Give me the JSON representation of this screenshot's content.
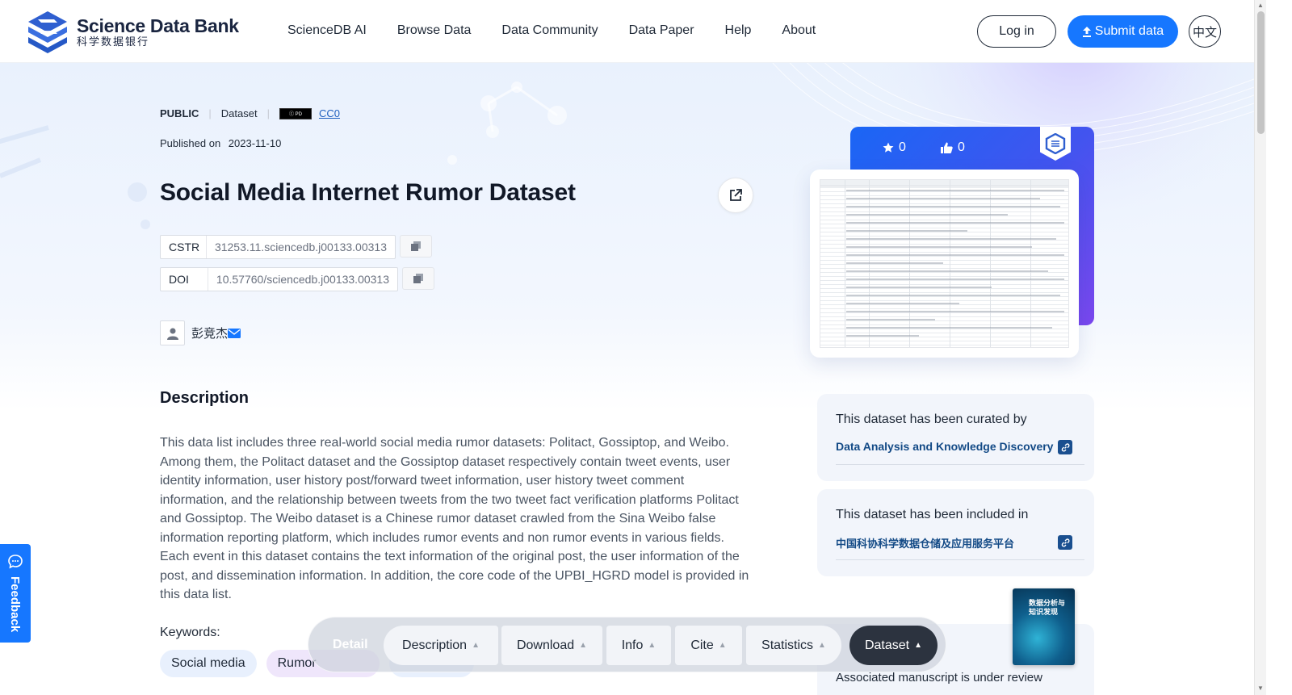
{
  "brand": {
    "name_en": "Science Data Bank",
    "name_cn": "科学数据银行"
  },
  "nav": [
    "ScienceDB AI",
    "Browse Data",
    "Data Community",
    "Data Paper",
    "Help",
    "About"
  ],
  "header_actions": {
    "login": "Log in",
    "submit": "Submit data",
    "lang": "中文"
  },
  "dataset": {
    "visibility": "PUBLIC",
    "type": "Dataset",
    "license": "CC0",
    "published_label": "Published on",
    "published_date": "2023-11-10",
    "title": "Social Media Internet Rumor Dataset",
    "cstr_label": "CSTR",
    "cstr": "31253.11.sciencedb.j00133.00313",
    "doi_label": "DOI",
    "doi": "10.57760/sciencedb.j00133.00313",
    "author": "彭竞杰"
  },
  "description": {
    "heading": "Description",
    "text": "This data list includes three real-world social media rumor datasets: Politact, Gossiptop, and Weibo. Among them, the Politact dataset and the Gossiptop dataset respectively contain tweet events, user identity information, user history post/forward tweet information, user history tweet comment information, and the relationship between tweets from the two tweet fact verification platforms Politact and Gossiptop. The Weibo dataset is a Chinese rumor dataset crawled from the Sina Weibo false information reporting platform, which includes rumor events and non rumor events in various fields. Each event in this dataset contains the text information of the original post, the user information of the post, and dissemination information. In addition, the core code of the UPBI_HGRD model is provided in this data list."
  },
  "keywords": {
    "label": "Keywords:",
    "items": [
      "Social media",
      "Rumor",
      ""
    ]
  },
  "stats": {
    "stars": "0",
    "likes": "0"
  },
  "curated": {
    "title": "This dataset has been curated by",
    "link": "Data Analysis and Knowledge Discovery"
  },
  "included": {
    "title": "This dataset has been included in",
    "link": "中国科协科学数据仓储及应用服务平台"
  },
  "journal": {
    "note": "Associated manuscript is under review",
    "cover_title": "数据分析与\n知识发现"
  },
  "float_nav": {
    "active": "Detail",
    "items": [
      "Description",
      "Download",
      "Info",
      "Cite",
      "Statistics",
      "Dataset"
    ]
  },
  "feedback": "Feedback",
  "colors": {
    "accent": "#1677ff",
    "link": "#134a86",
    "card_bg": "#f2f5fb"
  }
}
